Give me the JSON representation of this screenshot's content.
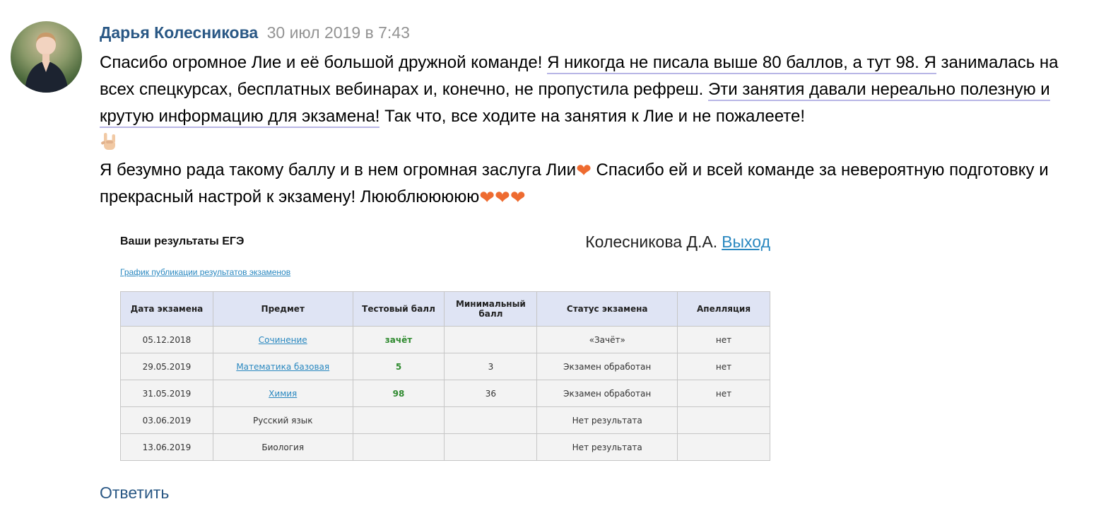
{
  "post": {
    "author": "Дарья Колесникова",
    "date": "30 июл 2019 в 7:43",
    "p1_a": "Спасибо огромное Лие и её большой дружной команде! ",
    "p1_b": "Я никогда не писала выше 80 баллов, а тут 98. Я",
    "p1_c": " занималась на всех спецкурсах, бесплатных вебинарах и, конечно, не пропустила рефреш. ",
    "p1_d": "Эти занятия давали нереально полезную и крутую информацию для экзамена!",
    "p1_e": " Так что, все ходите на занятия к Лие и не пожалеете!",
    "p2_a": "Я безумно рада такому баллу и в нем огромная заслуга Лии",
    "p2_b": " Спасибо ей и всей команде за невероятную подготовку и прекрасный настрой к экзамену! Лююблююююю",
    "heart": "❤",
    "hand_icon": "sign-of-the-horns-emoji",
    "reply_label": "Ответить"
  },
  "ege": {
    "title": "Ваши результаты ЕГЭ",
    "user_name": "Колесникова Д.А.",
    "logout_label": "Выход",
    "schedule_link": "График публикации результатов экзаменов",
    "columns": [
      "Дата экзамена",
      "Предмет",
      "Тестовый балл",
      "Минимальный балл",
      "Статус экзамена",
      "Апелляция"
    ],
    "rows": [
      {
        "date": "05.12.2018",
        "subject": "Сочинение",
        "subject_link": true,
        "score": "зачёт",
        "min": "",
        "status": "«Зачёт»",
        "appeal": "нет"
      },
      {
        "date": "29.05.2019",
        "subject": "Математика базовая",
        "subject_link": true,
        "score": "5",
        "min": "3",
        "status": "Экзамен обработан",
        "appeal": "нет"
      },
      {
        "date": "31.05.2019",
        "subject": "Химия",
        "subject_link": true,
        "score": "98",
        "min": "36",
        "status": "Экзамен обработан",
        "appeal": "нет"
      },
      {
        "date": "03.06.2019",
        "subject": "Русский язык",
        "subject_link": false,
        "score": "",
        "min": "",
        "status": "Нет результата",
        "appeal": ""
      },
      {
        "date": "13.06.2019",
        "subject": "Биология",
        "subject_link": false,
        "score": "",
        "min": "",
        "status": "Нет результата",
        "appeal": ""
      }
    ]
  },
  "colors": {
    "author": "#2a5885",
    "link": "#2a88c0",
    "score": "#2f8a2f",
    "heart": "#ee6b30",
    "header_bg": "#dfe4f4"
  }
}
